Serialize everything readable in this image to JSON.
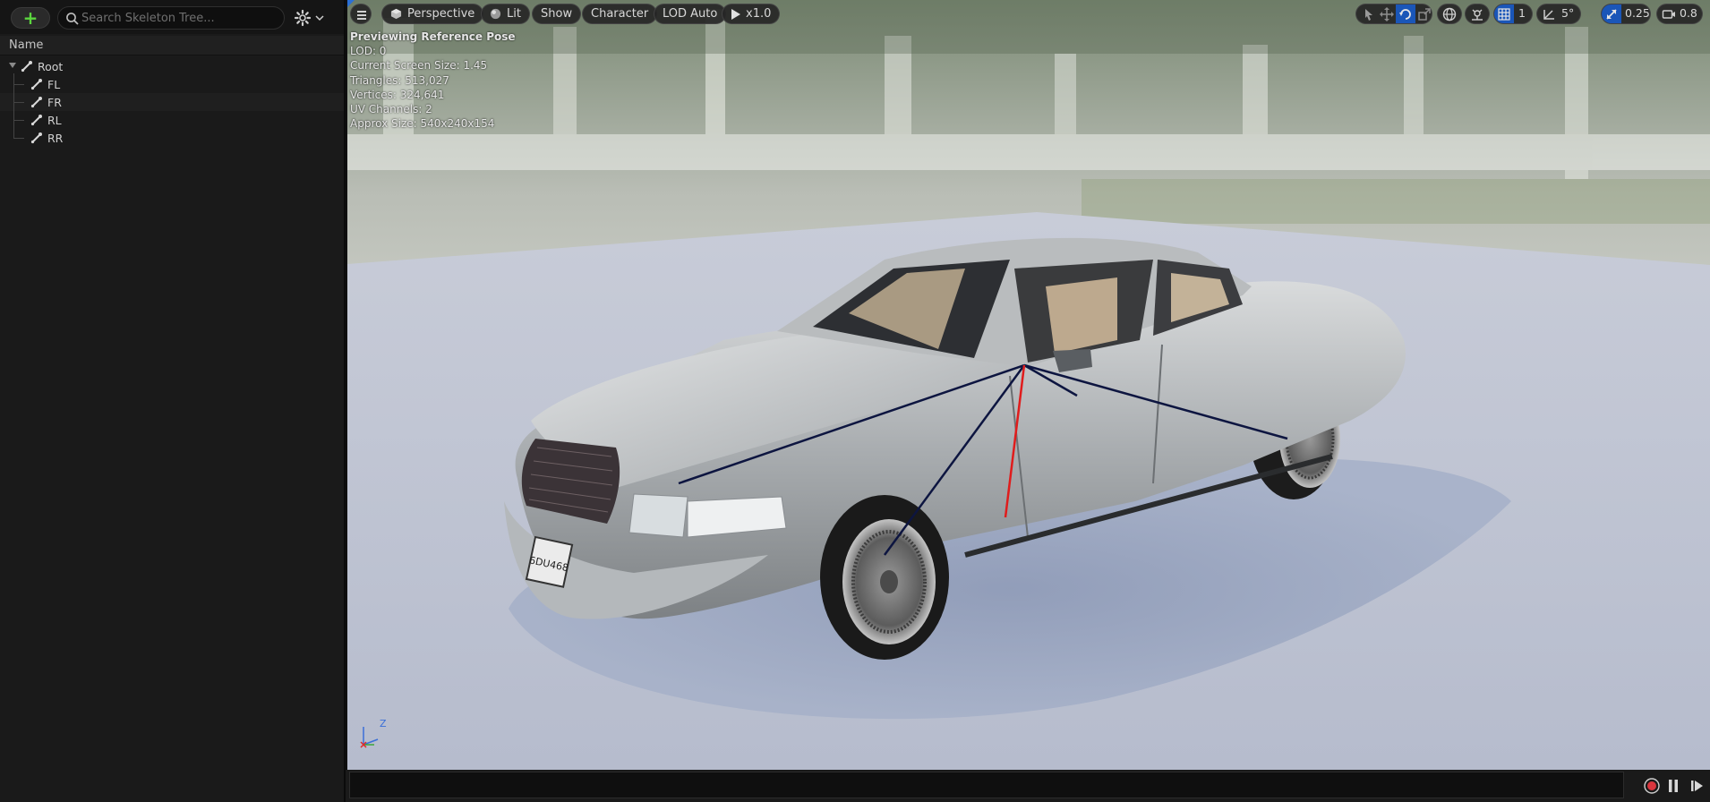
{
  "skeleton_tree": {
    "add_button_label": "+",
    "search_placeholder": "Search Skeleton Tree...",
    "column_header": "Name",
    "items": [
      {
        "label": "Root",
        "level": 0
      },
      {
        "label": "FL",
        "level": 1
      },
      {
        "label": "FR",
        "level": 1
      },
      {
        "label": "RL",
        "level": 1
      },
      {
        "label": "RR",
        "level": 1
      }
    ]
  },
  "viewport": {
    "toolbar": {
      "view_mode": "Perspective",
      "lighting": "Lit",
      "show": "Show",
      "character": "Character",
      "lod": "LOD Auto",
      "speed": "x1.0",
      "grid_snap": "1",
      "rotation_snap": "5°",
      "scale_snap": "0.25",
      "camera_speed": "0.8"
    },
    "stats": {
      "line1": "Previewing Reference Pose",
      "line2": "LOD: 0",
      "line3": "Current Screen Size: 1.45",
      "line4": "Triangles: 513,027",
      "line5": "Vertices: 324,641",
      "line6": "UV Channels: 2",
      "line7": "Approx Size: 540x240x154"
    },
    "license_plate": "6DU468",
    "axis_label": "Z"
  },
  "colors": {
    "accent_blue": "#2a6fd6",
    "add_green": "#5bd63e",
    "record_red": "#d9363e"
  }
}
